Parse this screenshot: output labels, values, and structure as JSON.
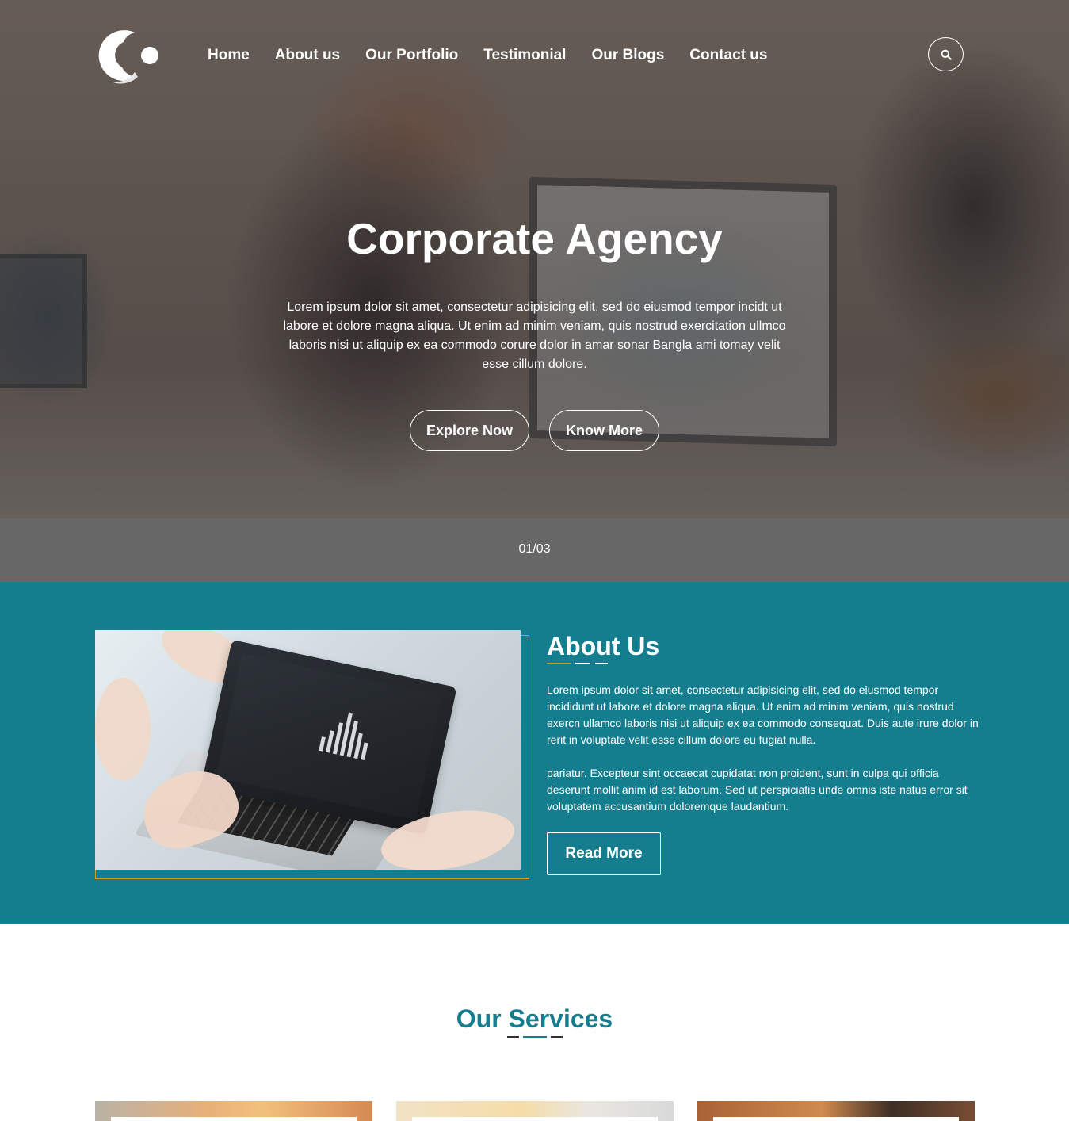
{
  "nav": {
    "items": [
      {
        "label": "Home"
      },
      {
        "label": "About us"
      },
      {
        "label": "Our Portfolio"
      },
      {
        "label": "Testimonial"
      },
      {
        "label": "Our Blogs"
      },
      {
        "label": "Contact us"
      }
    ],
    "search_icon": "search-icon",
    "logo_icon": "c-logo-icon"
  },
  "hero": {
    "title": "Corporate Agency",
    "text": "Lorem ipsum dolor sit amet, consectetur adipisicing elit, sed do eiusmod tempor incidt ut labore et dolore magna aliqua. Ut enim ad minim veniam, quis nostrud exercitation ullmco laboris nisi ut aliquip ex ea commodo corure dolor in amar sonar Bangla ami tomay velit esse cillum dolore.",
    "explore_label": "Explore Now",
    "know_label": "Know More"
  },
  "slider": {
    "counter": "01/03"
  },
  "about": {
    "title": "About Us",
    "paragraph1": "Lorem ipsum dolor sit amet, consectetur adipisicing elit, sed do eiusmod tempor incididunt ut labore et dolore magna aliqua. Ut enim ad minim veniam, quis nostrud exercn ullamco laboris nisi ut aliquip ex ea commodo consequat. Duis aute irure dolor in rerit in voluptate velit esse cillum dolore eu fugiat nulla.",
    "paragraph2": "pariatur. Excepteur sint occaecat cupidatat non proident, sunt in culpa qui officia deserunt mollit anim id est laborum. Sed ut perspiciatis unde omnis iste natus error sit voluptatem accusantium doloremque laudantium.",
    "read_more_label": "Read More"
  },
  "services": {
    "title": "Our Services"
  },
  "colors": {
    "teal": "#157e8e",
    "gold": "#c4a21c",
    "slider_gray": "#676767",
    "dash_dark": "#333333",
    "white": "#ffffff"
  }
}
